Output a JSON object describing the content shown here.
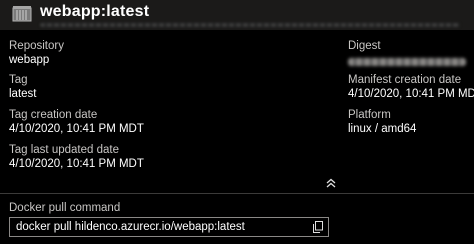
{
  "header": {
    "title": "webapp:latest",
    "icon": "container-image-icon"
  },
  "details": {
    "repository_label": "Repository",
    "repository_value": "webapp",
    "tag_label": "Tag",
    "tag_value": "latest",
    "tag_creation_label": "Tag creation date",
    "tag_creation_value": "4/10/2020, 10:41 PM MDT",
    "tag_updated_label": "Tag last updated date",
    "tag_updated_value": "4/10/2020, 10:41 PM MDT",
    "digest_label": "Digest",
    "manifest_creation_label": "Manifest creation date",
    "manifest_creation_value": "4/10/2020, 10:41 PM MDT",
    "platform_label": "Platform",
    "platform_value": "linux / amd64"
  },
  "docker_pull": {
    "label": "Docker pull command",
    "command": "docker pull hildenco.azurecr.io/webapp:latest"
  },
  "icons": {
    "collapse": "double-chevron-up-icon",
    "copy": "copy-icon"
  }
}
